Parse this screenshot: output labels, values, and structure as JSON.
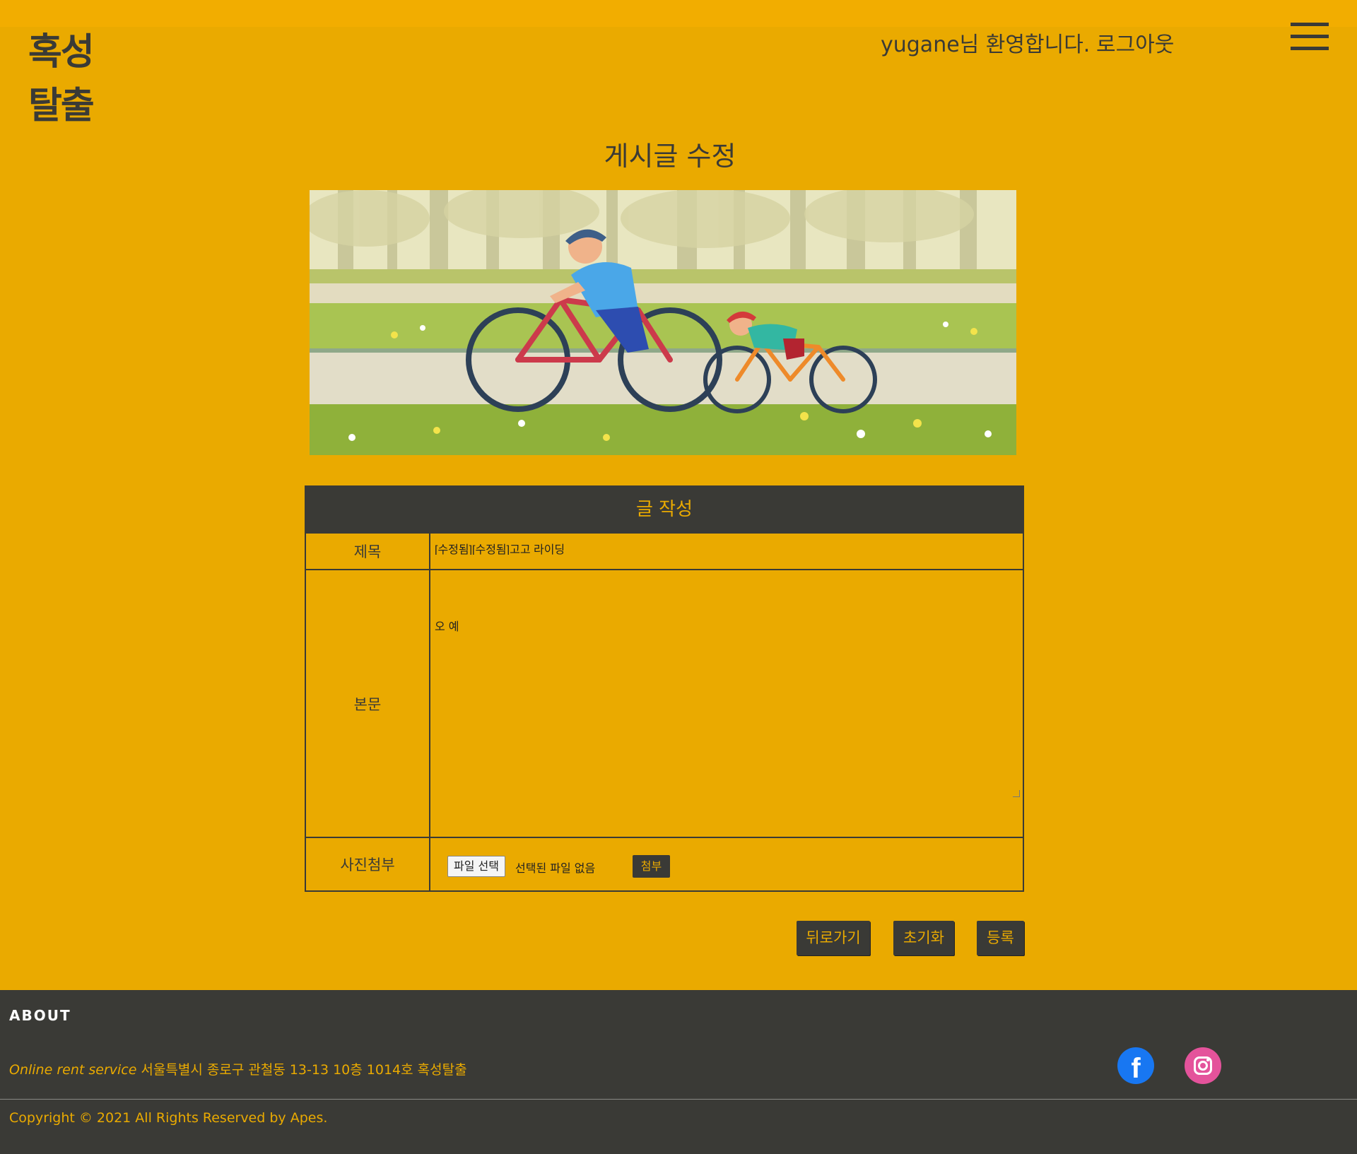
{
  "header": {
    "logo_line1": "혹성",
    "logo_line2": "탈출",
    "welcome": "yugane님 환영합니다.",
    "logout": "로그아웃"
  },
  "page": {
    "title": "게시글 수정"
  },
  "form": {
    "heading": "글 작성",
    "title_label": "제목",
    "title_value": "[수정됨][수정됨]고고 라이딩",
    "body_label": "본문",
    "body_value": "오 예",
    "file_label": "사진첨부",
    "file_button": "파일 선택",
    "file_status": "선택된 파일 없음",
    "attach_button": "첨부"
  },
  "actions": {
    "back": "뒤로가기",
    "reset": "초기화",
    "submit": "등록"
  },
  "footer": {
    "about": "ABOUT",
    "service_em": "Online rent service",
    "address": "서울특별시 종로구 관철동 13-13 10층 1014호 혹성탈출",
    "copyright": "Copyright © 2021 All Rights Reserved by Apes."
  },
  "icons": {
    "menu": "hamburger-icon",
    "facebook": "facebook-icon",
    "instagram": "instagram-icon"
  },
  "colors": {
    "background": "#eaaa00",
    "dark": "#3a3a36",
    "accent": "#eaaa00"
  }
}
